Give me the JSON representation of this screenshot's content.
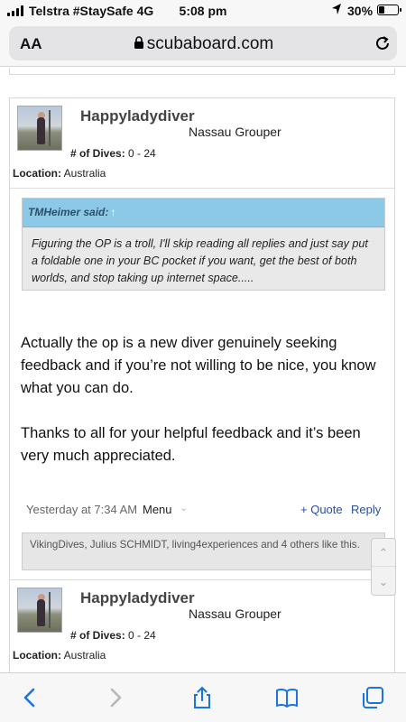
{
  "status_bar": {
    "carrier": "Telstra #StaySafe  4G",
    "time": "5:08 pm",
    "location_icon": "location-arrow-icon",
    "battery_percent": "30%",
    "battery_level": 0.3
  },
  "browser": {
    "text_size_label": "AA",
    "domain": "scubaboard.com",
    "lock_icon": "lock-icon",
    "reload_icon": "reload-icon"
  },
  "posts": [
    {
      "username": "Happyladydiver",
      "user_title": "Nassau Grouper",
      "dives_label": "# of Dives:",
      "dives_value": "0 - 24",
      "location_label": "Location:",
      "location_value": "Australia",
      "quote": {
        "author": "TMHeimer said:",
        "arrow": "↑",
        "text": "Figuring the OP is a troll, I'll skip reading all replies and just say put a foldable one in your BC pocket if you want, get the best of both worlds, and stop taking up internet space....."
      },
      "message": [
        "Actually the op is a new diver genuinely seeking feedback and if you’re not willing to be nice, you know what you can do.",
        "Thanks to all for your helpful feedback and it’s been very much appreciated."
      ],
      "date": "Yesterday at 7:34 AM",
      "menu_label": "Menu",
      "quote_button": "+ Quote",
      "reply_button": "Reply",
      "likes": "VikingDives, Julius SCHMIDT, living4experiences and 4 others like this."
    },
    {
      "username": "Happyladydiver",
      "user_title": "Nassau Grouper",
      "dives_label": "# of Dives:",
      "dives_value": "0 - 24",
      "location_label": "Location:",
      "location_value": "Australia"
    }
  ],
  "toolbar": {
    "icons": [
      "back-icon",
      "forward-icon",
      "share-icon",
      "bookmarks-icon",
      "tabs-icon"
    ]
  }
}
